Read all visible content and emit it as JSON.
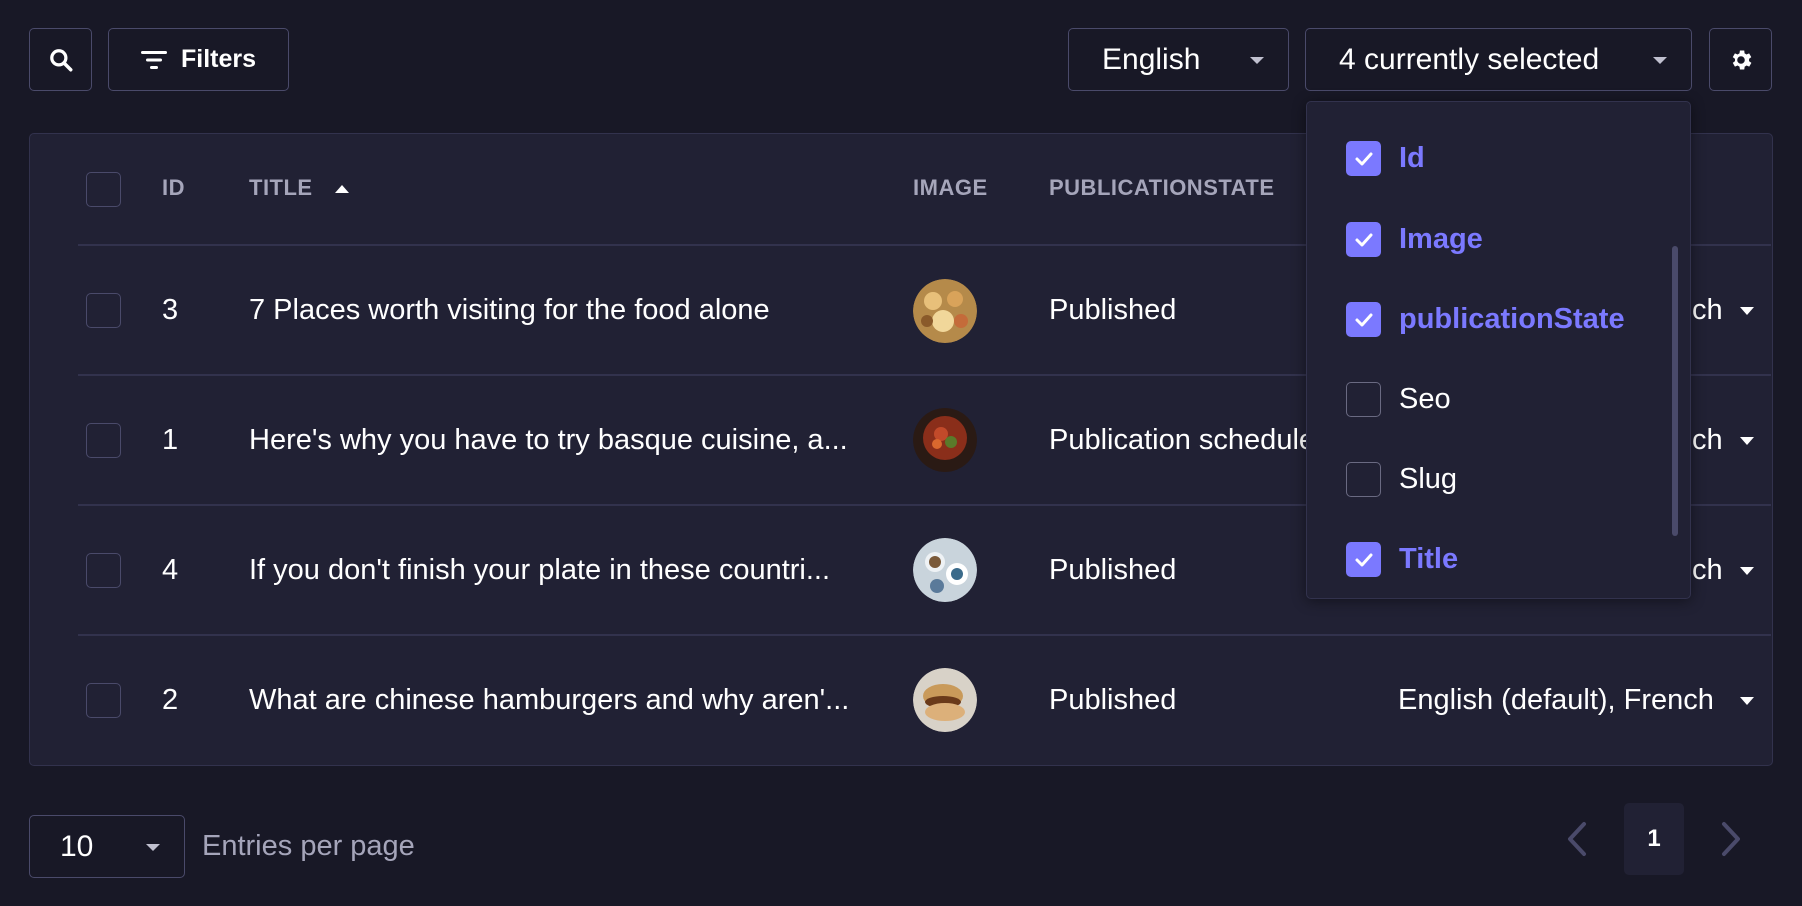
{
  "toolbar": {
    "filters_label": "Filters",
    "locale_select": "English",
    "columns_select": "4 currently selected"
  },
  "table": {
    "headers": {
      "id": "ID",
      "title": "TITLE",
      "image": "IMAGE",
      "publication_state": "PUBLICATIONSTATE"
    },
    "rows": [
      {
        "id": "3",
        "title": "7 Places worth visiting for the food alone",
        "publication_state": "Published",
        "locales": "ch"
      },
      {
        "id": "1",
        "title": "Here's why you have to try basque cuisine, a...",
        "publication_state": "Publication schedule",
        "locales": "ch"
      },
      {
        "id": "4",
        "title": "If you don't finish your plate in these countri...",
        "publication_state": "Published",
        "locales": "ch"
      },
      {
        "id": "2",
        "title": "What are chinese hamburgers and why aren'...",
        "publication_state": "Published",
        "locales": "English (default), French"
      }
    ]
  },
  "column_picker": {
    "options": [
      {
        "label": "Id",
        "checked": true
      },
      {
        "label": "Image",
        "checked": true
      },
      {
        "label": "publicationState",
        "checked": true
      },
      {
        "label": "Seo",
        "checked": false
      },
      {
        "label": "Slug",
        "checked": false
      },
      {
        "label": "Title",
        "checked": true
      }
    ]
  },
  "pagination": {
    "page_size": "10",
    "entries_label": "Entries per page",
    "current_page": "1"
  },
  "colors": {
    "background": "#181826",
    "surface": "#212134",
    "accent": "#7b79ff",
    "border": "#4a4a6a"
  }
}
